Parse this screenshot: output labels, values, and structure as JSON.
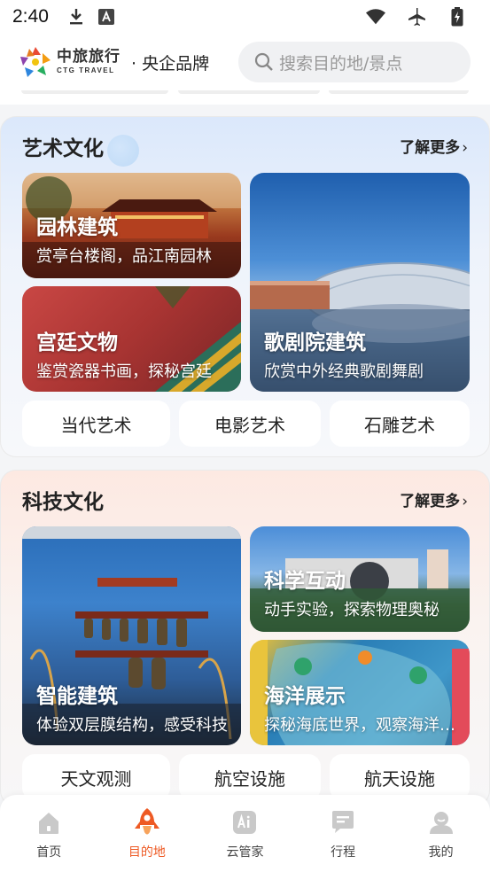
{
  "status": {
    "time": "2:40"
  },
  "header": {
    "logo_cn": "中旅旅行",
    "logo_en": "CTG TRAVEL",
    "brand": "· 央企品牌",
    "search_placeholder": "搜索目的地/景点"
  },
  "art": {
    "title": "艺术文化",
    "more": "了解更多",
    "cards": [
      {
        "title": "园林建筑",
        "subtitle": "赏亭台楼阁，品江南园林"
      },
      {
        "title": "宫廷文物",
        "subtitle": "鉴赏瓷器书画，探秘宫廷"
      },
      {
        "title": "歌剧院建筑",
        "subtitle": "欣赏中外经典歌剧舞剧"
      }
    ],
    "tags": [
      "当代艺术",
      "电影艺术",
      "石雕艺术"
    ]
  },
  "tech": {
    "title": "科技文化",
    "more": "了解更多",
    "cards": [
      {
        "title": "智能建筑",
        "subtitle": "体验双层膜结构，感受科技"
      },
      {
        "title": "科学互动",
        "subtitle": "动手实验，探索物理奥秘"
      },
      {
        "title": "海洋展示",
        "subtitle": "探秘海底世界，观察海洋生物"
      }
    ],
    "tags": [
      "天文观测",
      "航空设施",
      "航天设施"
    ]
  },
  "tabs": [
    {
      "label": "首页",
      "icon": "home-icon"
    },
    {
      "label": "目的地",
      "icon": "rocket-icon",
      "active": true
    },
    {
      "label": "云管家",
      "icon": "ai-icon"
    },
    {
      "label": "行程",
      "icon": "itinerary-icon"
    },
    {
      "label": "我的",
      "icon": "profile-icon"
    }
  ],
  "colors": {
    "accent": "#ee5a24",
    "tab_icon": "#c9c9c9"
  }
}
